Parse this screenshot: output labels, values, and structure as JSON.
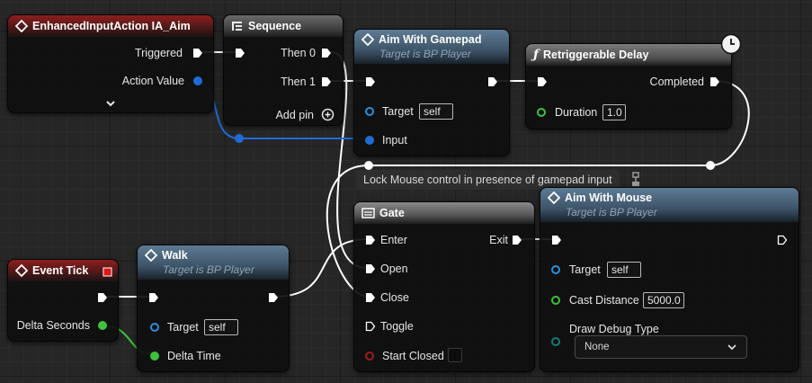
{
  "colors": {
    "exec": "#ffffff",
    "event_header": "#8e1e1e",
    "function_header": "#3d5468",
    "macro_header": "#4a5d56",
    "sequence_header": "#5a5a5a",
    "object_pin": "#2a8fe0",
    "float_pin": "#3ec23e",
    "bool_pin": "#a01d1d",
    "enum_pin": "#157a78"
  },
  "nodes": {
    "input_action": {
      "title": "EnhancedInputAction IA_Aim",
      "icon": "event-diamond-icon",
      "pins": {
        "triggered": "Triggered",
        "action_value": "Action Value"
      }
    },
    "sequence": {
      "title": "Sequence",
      "icon": "sequence-icon",
      "pins": {
        "then0": "Then 0",
        "then1": "Then 1",
        "add_pin": "Add pin"
      }
    },
    "aim_gamepad": {
      "title": "Aim With Gamepad",
      "subtitle": "Target is BP Player",
      "icon": "function-diamond-icon",
      "pins": {
        "target": "Target",
        "target_value": "self",
        "input": "Input"
      }
    },
    "retrig_delay": {
      "title": "Retriggerable Delay",
      "icon": "function-f-icon",
      "latent_icon": "clock-icon",
      "pins": {
        "completed": "Completed",
        "duration": "Duration",
        "duration_value": "1.0"
      }
    },
    "event_tick": {
      "title": "Event Tick",
      "icon": "event-diamond-icon",
      "pins": {
        "delta_seconds": "Delta Seconds"
      }
    },
    "walk": {
      "title": "Walk",
      "subtitle": "Target is BP Player",
      "icon": "function-diamond-icon",
      "pins": {
        "target": "Target",
        "target_value": "self",
        "delta_time": "Delta Time"
      }
    },
    "gate": {
      "title": "Gate",
      "icon": "gate-macro-icon",
      "pins": {
        "enter": "Enter",
        "open": "Open",
        "close": "Close",
        "toggle": "Toggle",
        "start_closed": "Start Closed",
        "exit": "Exit"
      }
    },
    "aim_mouse": {
      "title": "Aim With Mouse",
      "subtitle": "Target is BP Player",
      "icon": "function-diamond-icon",
      "pins": {
        "target": "Target",
        "target_value": "self",
        "cast_distance": "Cast Distance",
        "cast_distance_value": "5000.0",
        "draw_debug_type": "Draw Debug Type",
        "draw_debug_value": "None"
      }
    }
  },
  "comment": {
    "text": "Lock Mouse control in presence of gamepad input"
  }
}
